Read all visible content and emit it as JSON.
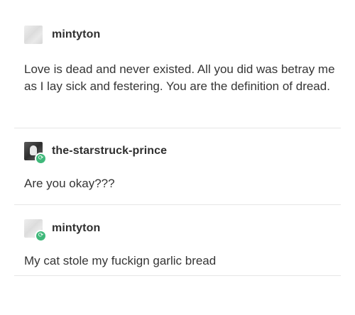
{
  "posts": [
    {
      "username": "mintyton",
      "avatar_icon": "blurred-avatar",
      "is_reblog": false,
      "text": "Love is dead and never existed. All you did was betray me as I lay sick and festering. You are the definition of dread."
    },
    {
      "username": "the-starstruck-prince",
      "avatar_icon": "figure-avatar",
      "is_reblog": true,
      "text": "Are you okay???"
    },
    {
      "username": "mintyton",
      "avatar_icon": "blurred-avatar",
      "is_reblog": true,
      "text": "My cat stole my fuckign garlic bread"
    }
  ],
  "colors": {
    "reblog_badge": "#3fb87a",
    "divider": "#e6e6e6",
    "text": "#353535"
  }
}
